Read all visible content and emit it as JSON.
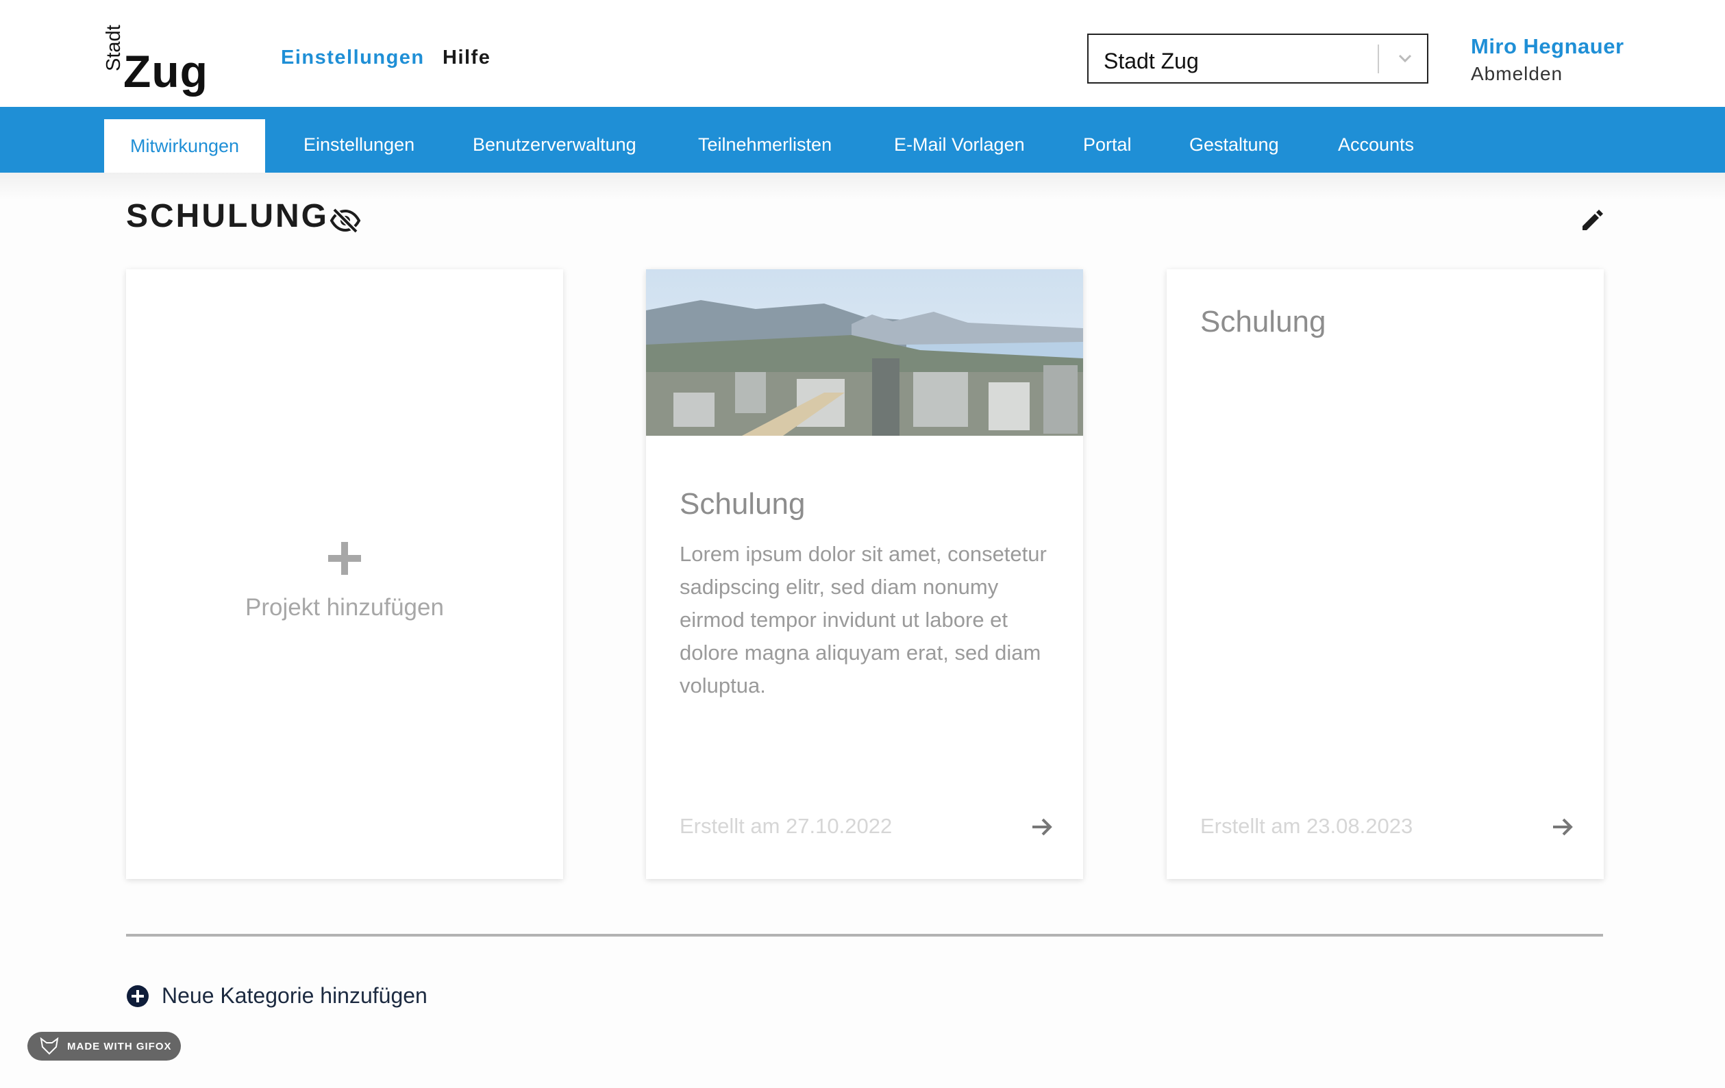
{
  "header": {
    "logo_small": "Stadt",
    "logo_big": "Zug",
    "links": [
      "Einstellungen",
      "Hilfe"
    ],
    "org_select_value": "Stadt Zug",
    "user_name": "Miro Hegnauer",
    "logout_label": "Abmelden"
  },
  "nav": {
    "items": [
      "Mitwirkungen",
      "Einstellungen",
      "Benutzerverwaltung",
      "Teilnehmerlisten",
      "E-Mail Vorlagen",
      "Portal",
      "Gestaltung",
      "Accounts"
    ],
    "active_index": 0
  },
  "category": {
    "title": "SCHULUNG",
    "visibility_icon": "eye-off-icon",
    "edit_icon": "pencil-icon"
  },
  "cards": {
    "add_label": "Projekt hinzufügen",
    "projects": [
      {
        "title": "Schulung",
        "description": "Lorem ipsum dolor sit amet, consetetur sadipscing elitr, sed diam nonumy eirmod tempor invidunt ut labore et dolore magna aliquyam erat, sed diam voluptua.",
        "created": "Erstellt am 27.10.2022",
        "has_image": true
      },
      {
        "title": "Schulung",
        "description": "",
        "created": "Erstellt am 23.08.2023",
        "has_image": false
      }
    ]
  },
  "footer": {
    "new_category_label": "Neue Kategorie hinzufügen",
    "badge": "MADE WITH GIFOX"
  },
  "colors": {
    "primary": "#1f8fd6",
    "text_dark": "#1c1c1c",
    "muted": "#8d8d8d"
  }
}
